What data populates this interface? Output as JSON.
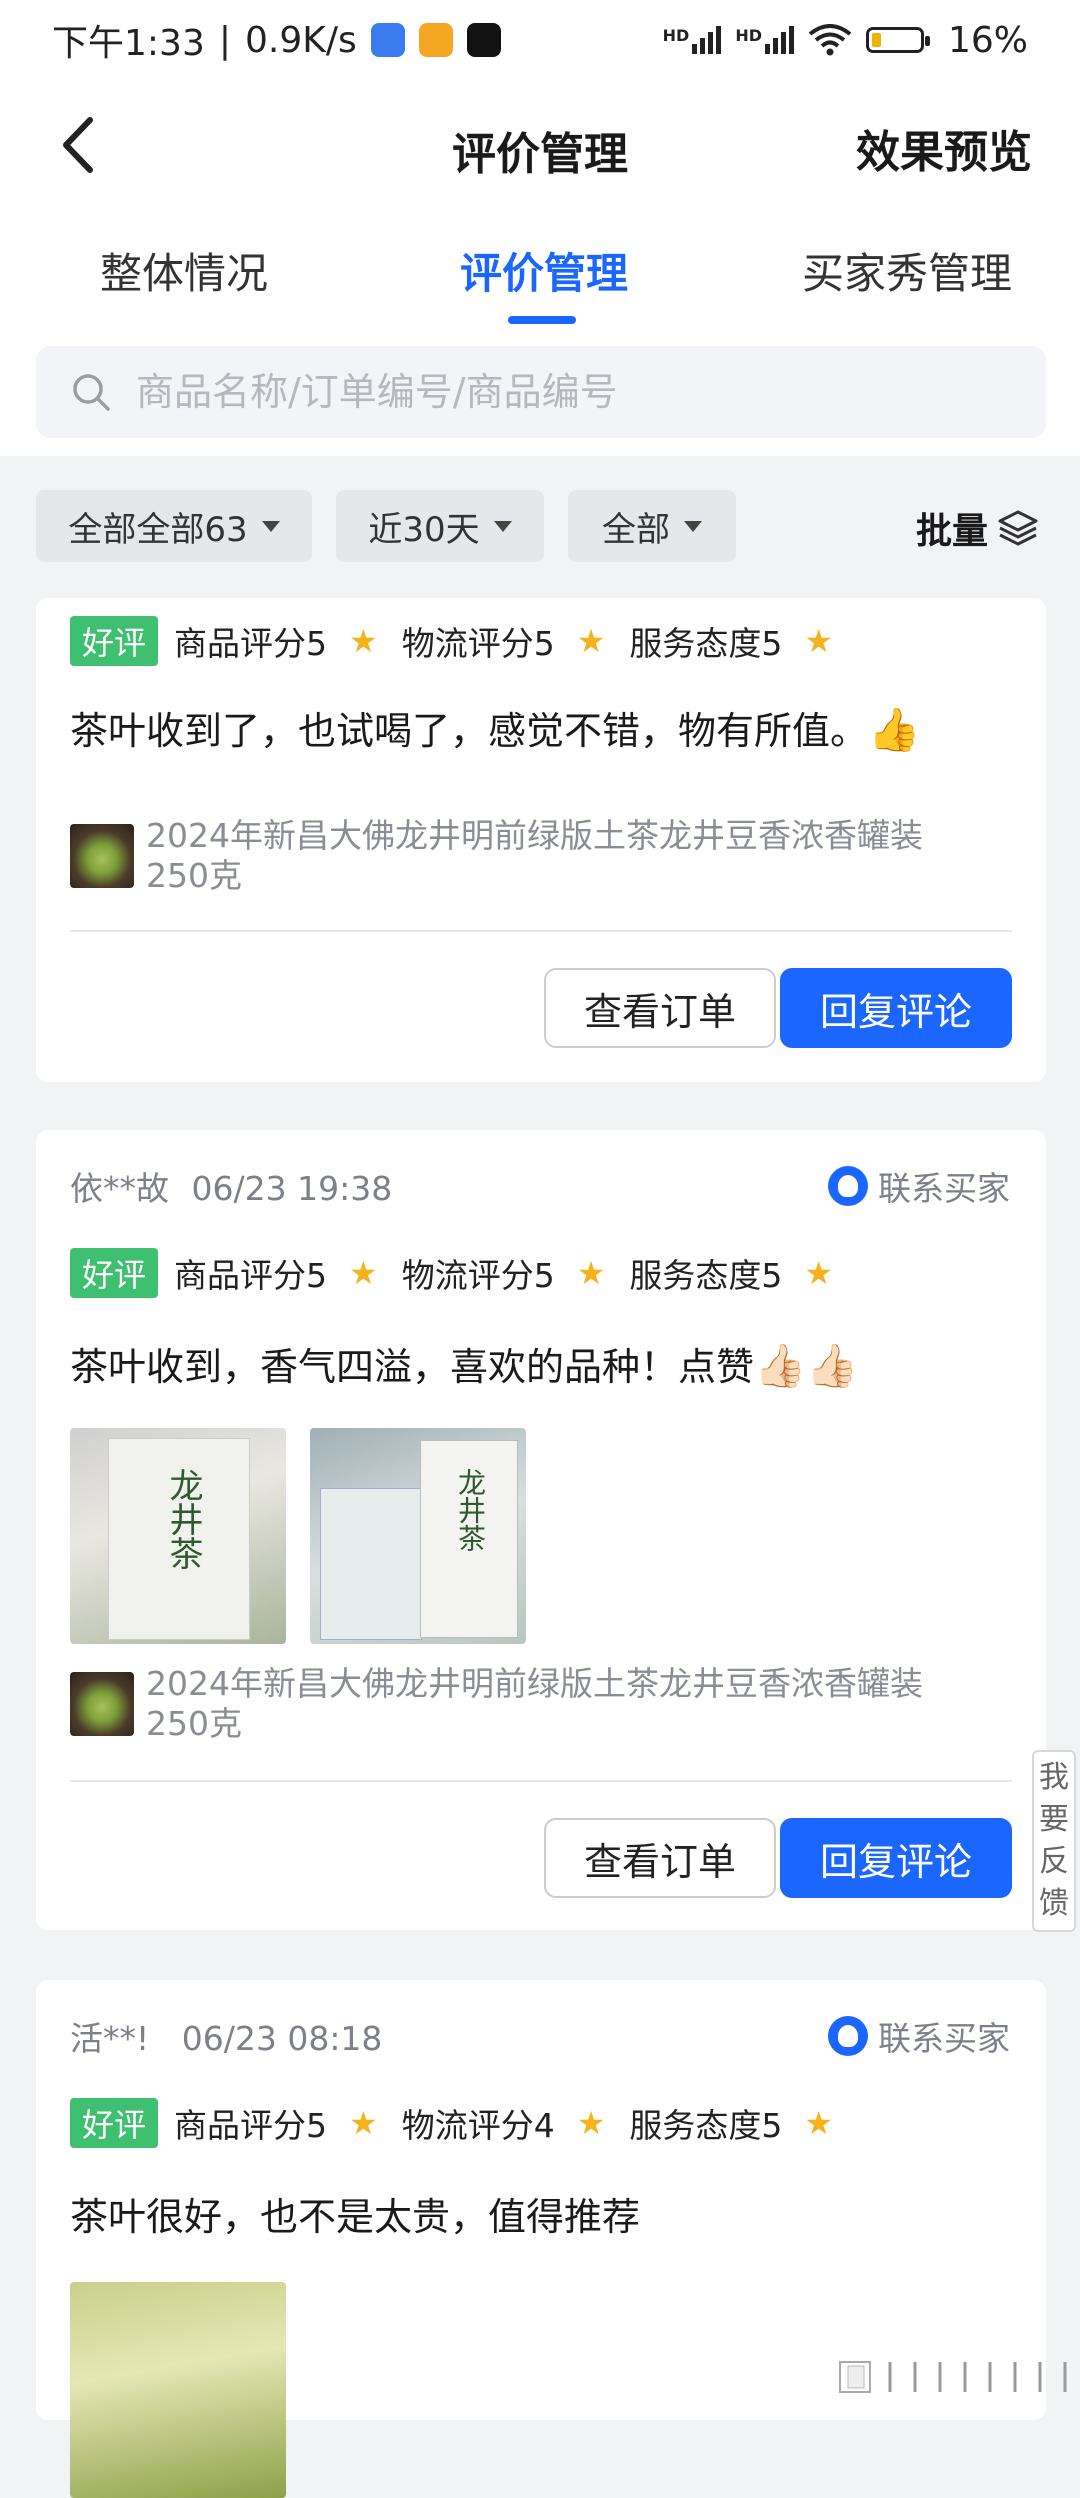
{
  "status": {
    "time": "下午1:33",
    "speed": "0.9K/s",
    "net1": "HD",
    "net2": "HD",
    "battery": "16%"
  },
  "nav": {
    "title": "评价管理",
    "right_action": "效果预览"
  },
  "tabs": [
    "整体情况",
    "评价管理",
    "买家秀管理"
  ],
  "search": {
    "placeholder": "商品名称/订单编号/商品编号"
  },
  "filters": {
    "all_label": "全部全部63",
    "period_label": "近30天",
    "type_label": "全部",
    "batch_label": "批量"
  },
  "reviews": [
    {
      "user": "",
      "date": "",
      "tag": "好评",
      "product_score": "商品评分5",
      "logistics_score": "物流评分5",
      "service_score": "服务态度5",
      "text": "茶叶收到了，也试喝了，感觉不错，物有所值。",
      "emoji": "👍",
      "product_name": "2024年新昌大佛龙井明前绿版土茶龙井豆香浓香罐装250克",
      "btn_view": "查看订单",
      "btn_reply": "回复评论"
    },
    {
      "user": "依**故",
      "date": "06/23 19:38",
      "contact": "联系买家",
      "tag": "好评",
      "product_score": "商品评分5",
      "logistics_score": "物流评分5",
      "service_score": "服务态度5",
      "text": "茶叶收到，香气四溢，喜欢的品种！点赞",
      "emoji": "👍🏻👍🏻",
      "photo_label": "龙井茶",
      "product_name": "2024年新昌大佛龙井明前绿版土茶龙井豆香浓香罐装250克",
      "btn_view": "查看订单",
      "btn_reply": "回复评论"
    },
    {
      "user": "活**!",
      "date": "06/23 08:18",
      "contact": "联系买家",
      "tag": "好评",
      "product_score": "商品评分5",
      "logistics_score": "物流评分4",
      "service_score": "服务态度5",
      "text": "茶叶很好，也不是太贵，值得推荐"
    }
  ],
  "feedback": "我要反馈"
}
